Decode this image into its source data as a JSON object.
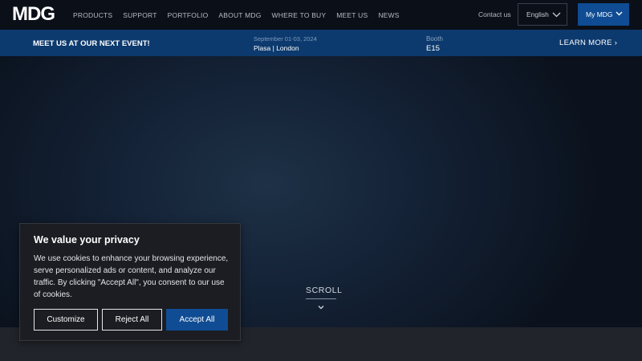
{
  "nav": {
    "logo": "MDG",
    "links": [
      "PRODUCTS",
      "SUPPORT",
      "PORTFOLIO",
      "ABOUT MDG",
      "WHERE TO BUY",
      "MEET US",
      "NEWS"
    ],
    "contact": "Contact us",
    "language": "English",
    "account": "My MDG"
  },
  "event": {
    "title": "MEET US AT OUR NEXT EVENT!",
    "date": "September 01-03, 2024",
    "place": "Plasa | London",
    "booth_label": "Booth",
    "booth_value": "E15",
    "learn_more": "LEARN MORE ›"
  },
  "hero": {
    "scroll_label": "SCROLL"
  },
  "cookie": {
    "title": "We value your privacy",
    "body": "We use cookies to enhance your browsing experience, serve personalized ads or content, and analyze our traffic. By clicking \"Accept All\", you consent to our use of cookies.",
    "customize": "Customize",
    "reject": "Reject All",
    "accept": "Accept All"
  },
  "colors": {
    "accent": "#0f4c93",
    "event_bar": "#0d3a6e",
    "nav_bg": "#0a0f18"
  },
  "icons": [
    "chevron-down-icon",
    "scroll-down-icon"
  ]
}
